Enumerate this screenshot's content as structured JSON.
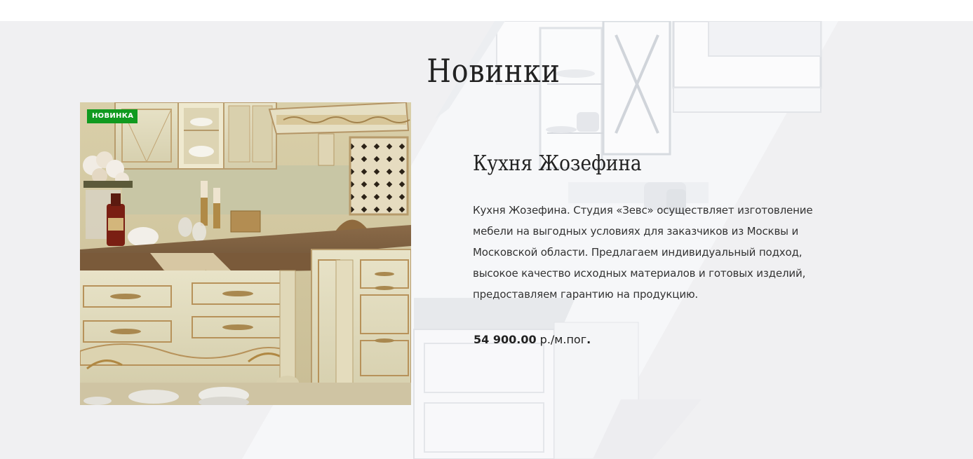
{
  "section": {
    "title": "Новинки"
  },
  "product": {
    "badge": "НОВИНКА",
    "name": "Кухня Жозефина",
    "description": "Кухня Жозефина. Студия «Зевс» осуществляет изготовление мебели на выгодных условиях для заказчиков из Москвы и Московской области. Предлагаем индивидуальный подход, высокое качество исходных материалов и готовых изделий, предоставляем гарантию на продукцию.",
    "price_value": "54 900.00",
    "price_unit": " р./м.пог",
    "price_dot": "."
  },
  "colors": {
    "badge_bg": "#109a1f",
    "section_bg": "#f0f0f2",
    "text": "#222222"
  },
  "icons": {
    "background": "kitchen-photo-background",
    "product": "kitchen-product-photo"
  }
}
